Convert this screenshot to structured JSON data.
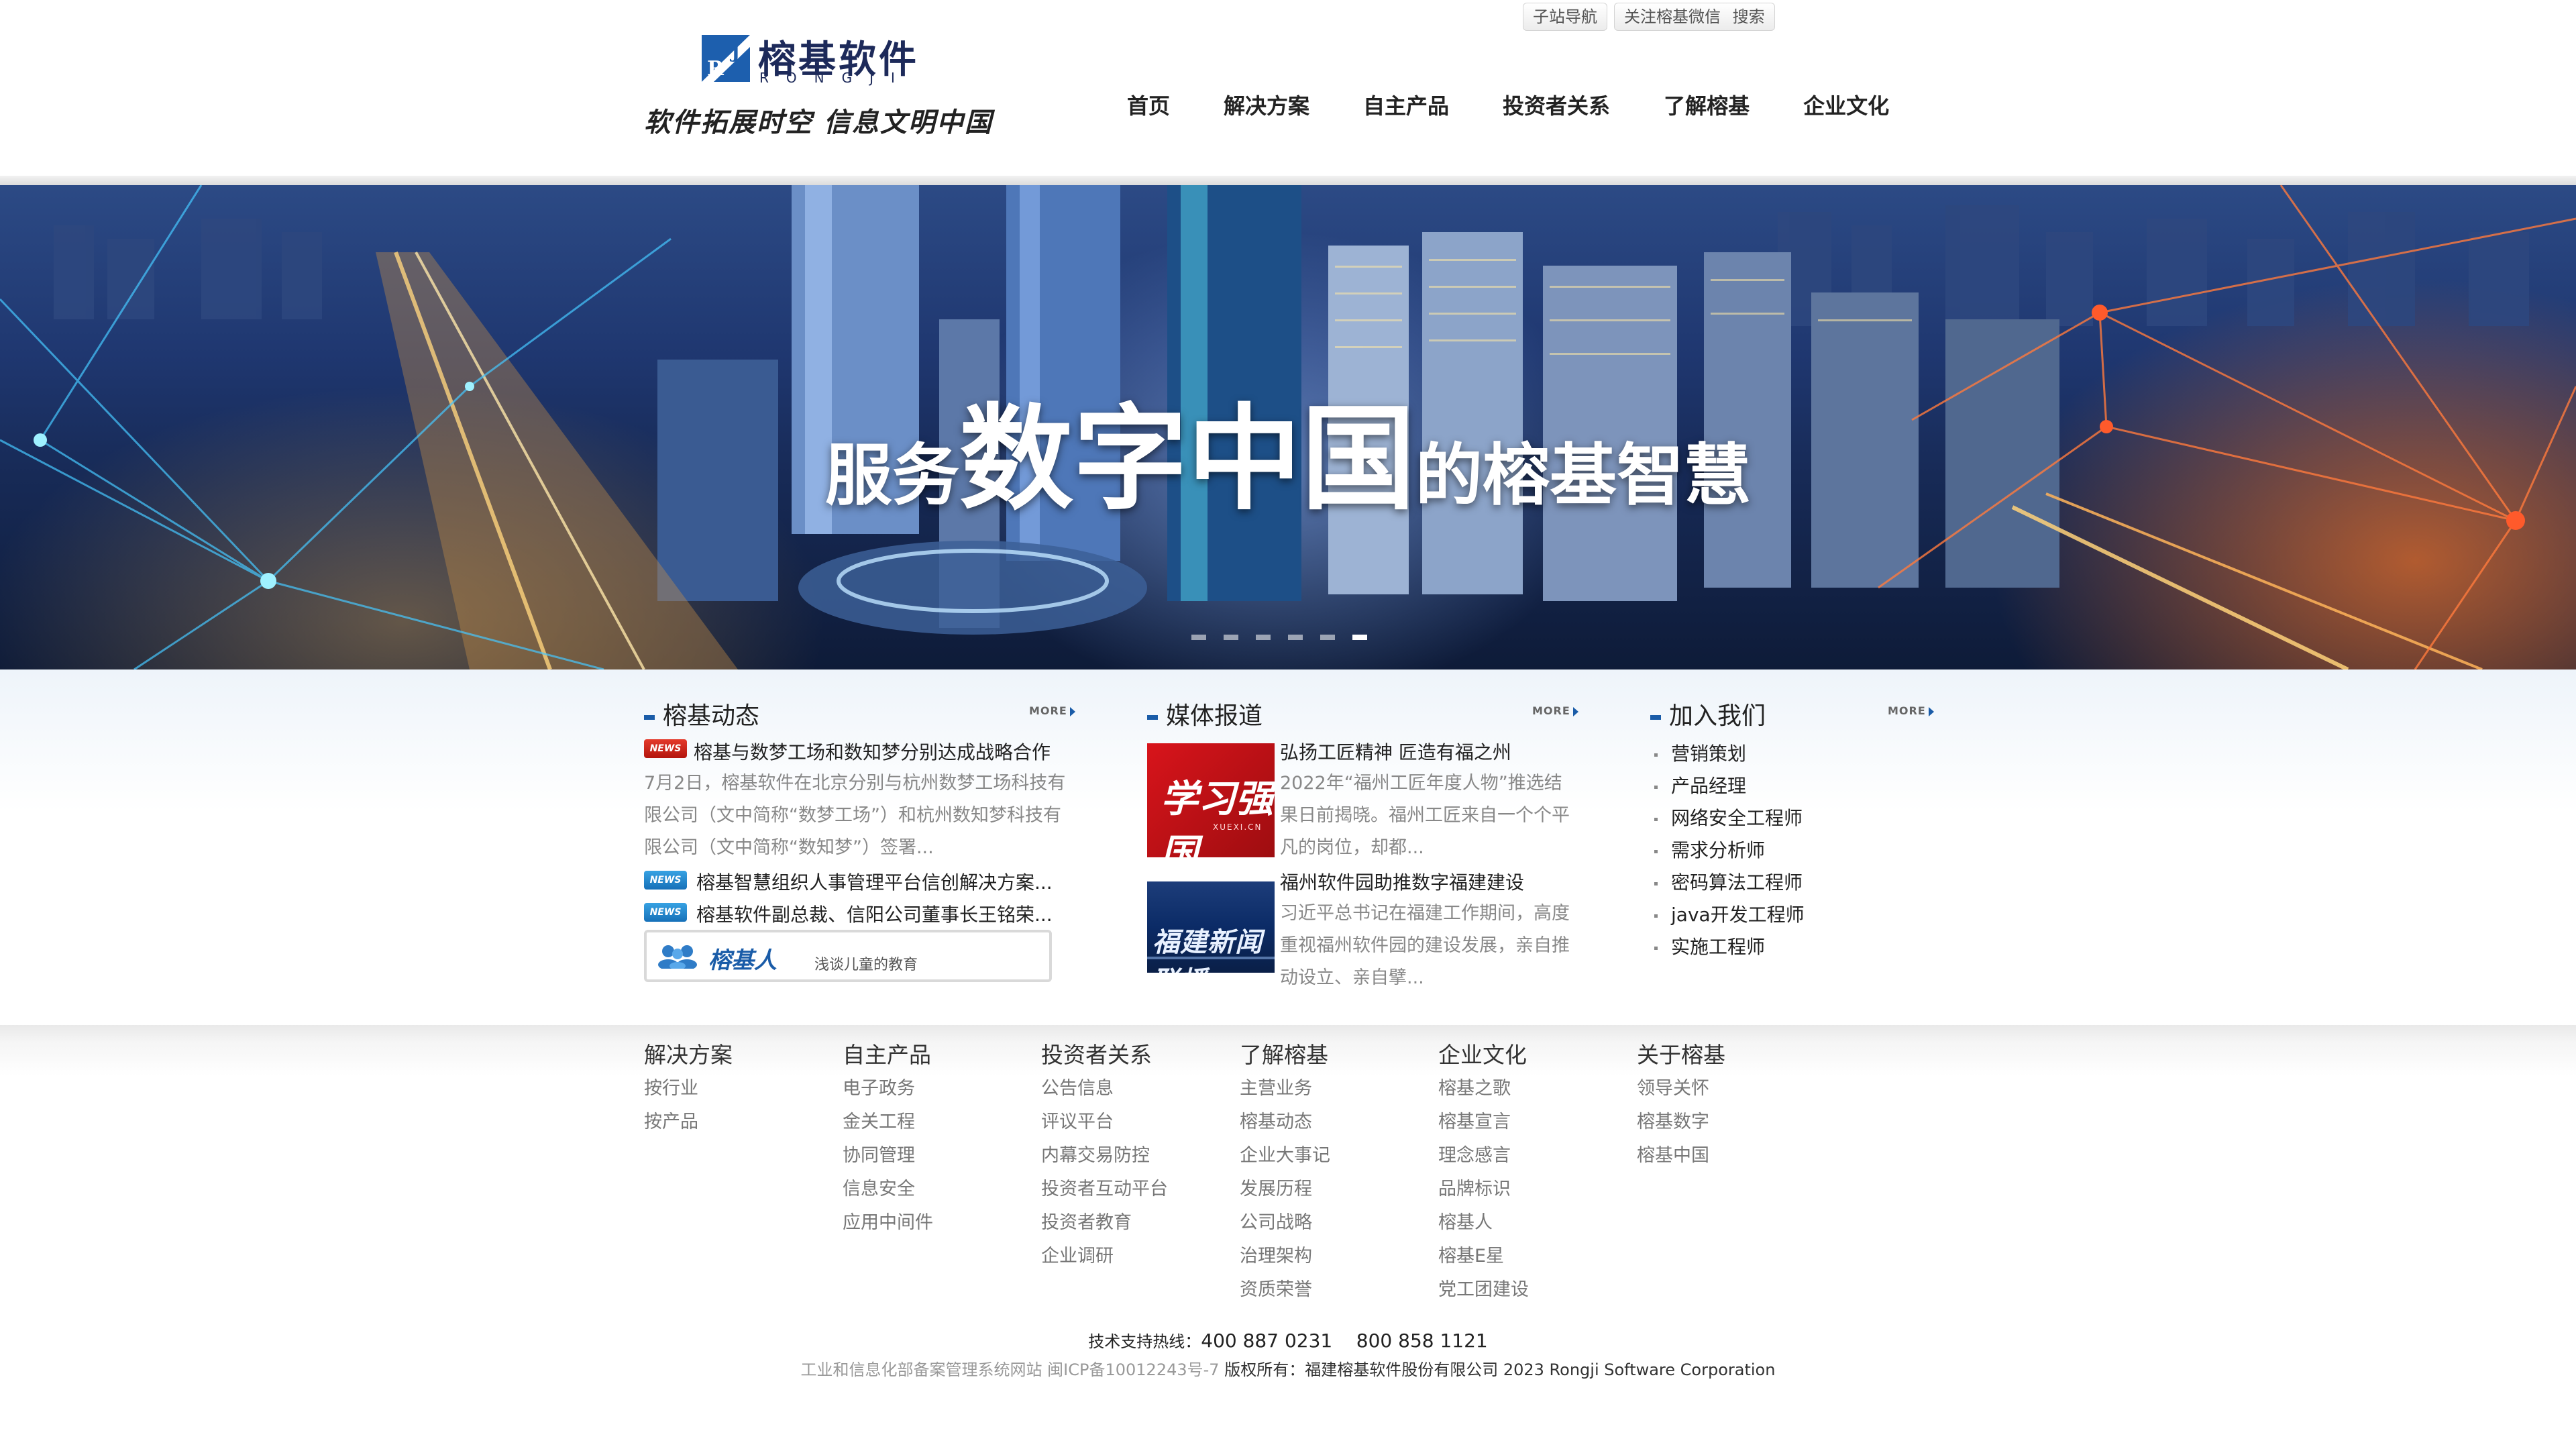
{
  "header": {
    "logo": {
      "name": "榕基软件",
      "sub": "RONGJI",
      "slogan": "软件拓展时空 信息文明中国"
    },
    "top_links": [
      "子站导航",
      "关注榕基微信",
      "搜索"
    ],
    "nav": [
      "首页",
      "解决方案",
      "自主产品",
      "投资者关系",
      "了解榕基",
      "企业文化"
    ]
  },
  "banner": {
    "title_parts": [
      "服务",
      "数字中国",
      "的榕基智慧"
    ],
    "slide_count": 6,
    "active_slide": 5
  },
  "news": {
    "title": "榕基动态",
    "more": "MORE",
    "featured": {
      "badge": "NEWS",
      "headline": "榕基与数梦工场和数知梦分别达成战略合作",
      "summary": "7月2日，榕基软件在北京分别与杭州数梦工场科技有限公司（文中简称“数梦工场”）和杭州数知梦科技有限公司（文中简称“数知梦”）签署..."
    },
    "items": [
      {
        "badge": "NEWS",
        "text": "榕基智慧组织人事管理平台信创解决方案..."
      },
      {
        "badge": "NEWS",
        "text": "榕基软件副总裁、信阳公司董事长王铭荣..."
      }
    ],
    "rongji_box": {
      "label": "榕基人",
      "tag": "浅谈儿童的教育"
    }
  },
  "media": {
    "title": "媒体报道",
    "more": "MORE",
    "items": [
      {
        "image_text": "学习强国",
        "image_sub": "XUEXI.CN",
        "headline": "弘扬工匠精神 匠造有福之州",
        "summary": "2022年“福州工匠年度人物”推选结果日前揭晓。福州工匠来自一个个平凡的岗位，却都..."
      },
      {
        "image_text": "福建新闻联播",
        "headline": "福州软件园助推数字福建建设",
        "summary": "习近平总书记在福建工作期间，高度重视福州软件园的建设发展，亲自推动设立、亲自擘..."
      }
    ]
  },
  "jobs": {
    "title": "加入我们",
    "more": "MORE",
    "items": [
      "营销策划",
      "产品经理",
      "网络安全工程师",
      "需求分析师",
      "密码算法工程师",
      "java开发工程师",
      "实施工程师"
    ]
  },
  "footer": {
    "columns": [
      {
        "heading": "解决方案",
        "links": [
          "按行业",
          "按产品"
        ]
      },
      {
        "heading": "自主产品",
        "links": [
          "电子政务",
          "金关工程",
          "协同管理",
          "信息安全",
          "应用中间件"
        ]
      },
      {
        "heading": "投资者关系",
        "links": [
          "公告信息",
          "评议平台",
          "内幕交易防控",
          "投资者互动平台",
          "投资者教育",
          "企业调研"
        ]
      },
      {
        "heading": "了解榕基",
        "links": [
          "主营业务",
          "榕基动态",
          "企业大事记",
          "发展历程",
          "公司战略",
          "治理架构",
          "资质荣誉"
        ]
      },
      {
        "heading": "企业文化",
        "links": [
          "榕基之歌",
          "榕基宣言",
          "理念感言",
          "品牌标识",
          "榕基人",
          "榕基E星",
          "党工团建设"
        ]
      },
      {
        "heading": "关于榕基",
        "links": [
          "领导关怀",
          "榕基数字",
          "榕基中国"
        ]
      }
    ],
    "hotline_label": "技术支持热线：",
    "hotline_numbers": "400 887 0231    800 858 1121",
    "icp": "工业和信息化部备案管理系统网站 闽ICP备10012243号-7",
    "copyright": "版权所有：福建榕基软件股份有限公司 2023 Rongji Software Corporation"
  },
  "colors": {
    "accent": "#1a5ca8",
    "news_red": "#d7191c",
    "news_blue": "#1d82cc"
  }
}
